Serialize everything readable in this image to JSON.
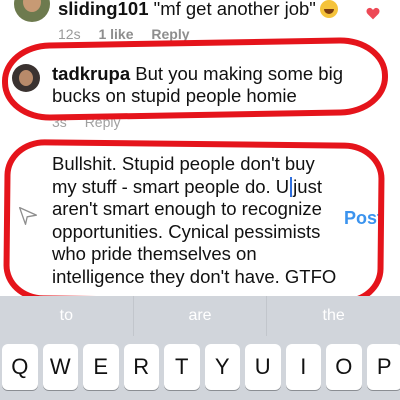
{
  "comments": [
    {
      "username": "sliding101",
      "text": "\"mf get another job\"",
      "emoji": "laughing-tears-emoji",
      "meta": {
        "age": "12s",
        "likes": "1 like",
        "reply": "Reply"
      },
      "liked": true
    },
    {
      "username": "tadkrupa",
      "text": "But you making some big bucks on stupid people homie",
      "meta": {
        "age": "3s",
        "reply": "Reply"
      }
    }
  ],
  "compose": {
    "draft_before_cursor": "Bullshit. Stupid people don't buy my stuff - smart people do. U",
    "draft_after_cursor": "just aren't smart enough to recognize opportunities. Cynical pessimists who pride themselves on intelligence they don't have. GTFO @tadkrupa",
    "post_label": "Post",
    "send_icon": "paper-plane-icon"
  },
  "keyboard": {
    "suggestions": [
      "to",
      "are",
      "the"
    ],
    "top_row": [
      "Q",
      "W",
      "E",
      "R",
      "T",
      "Y",
      "U",
      "I",
      "O",
      "P"
    ]
  },
  "colors": {
    "annotation_red": "#e5141b",
    "post_blue": "#3b93ee",
    "heart_red": "#ed4956",
    "keyboard_bg": "#d1d5db"
  }
}
